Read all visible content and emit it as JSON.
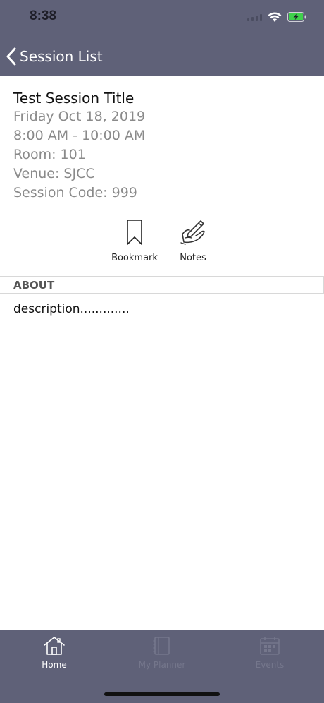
{
  "status_bar": {
    "time": "8:38"
  },
  "nav": {
    "back_label": "Session List"
  },
  "session": {
    "title": "Test Session Title",
    "date": "Friday Oct 18, 2019",
    "time_range": "8:00 AM - 10:00 AM",
    "room": "Room: 101",
    "venue": "Venue: SJCC",
    "code": "Session Code: 999"
  },
  "actions": {
    "bookmark_label": "Bookmark",
    "notes_label": "Notes"
  },
  "about": {
    "title": "ABOUT",
    "description": "description............."
  },
  "tabbar": {
    "home_label": "Home",
    "planner_label": "My Planner",
    "events_label": "Events"
  },
  "colors": {
    "header_bg": "#5f6178",
    "battery_green": "#3fd04c",
    "inactive_tab": "#75778c"
  }
}
